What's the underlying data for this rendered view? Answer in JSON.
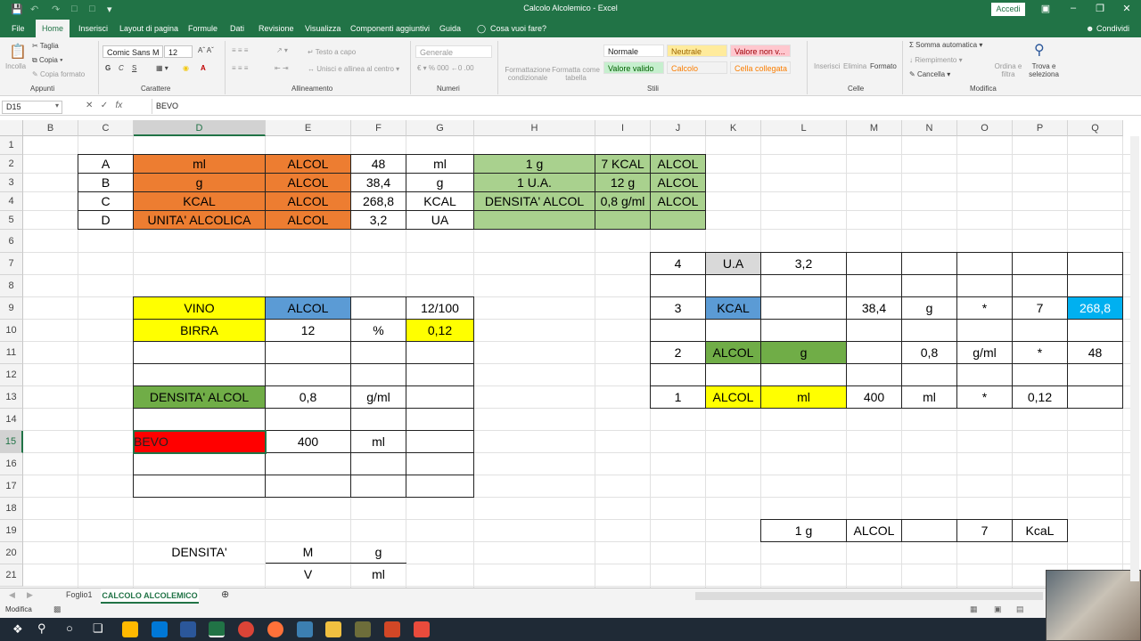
{
  "window": {
    "title": "Calcolo Alcolemico - Excel",
    "signin": "Accedi",
    "share": "Condividi"
  },
  "tabs": [
    "File",
    "Home",
    "Inserisci",
    "Layout di pagina",
    "Formule",
    "Dati",
    "Revisione",
    "Visualizza",
    "Componenti aggiuntivi",
    "Guida",
    "Cosa vuoi fare?"
  ],
  "ribbon": {
    "clipboard": {
      "paste": "Incolla",
      "cut": "Taglia",
      "copy": "Copia",
      "painter": "Copia formato",
      "group": "Appunti"
    },
    "font": {
      "name": "Comic Sans M",
      "size": "12",
      "group": "Carattere"
    },
    "align": {
      "wrap": "Testo a capo",
      "merge": "Unisci e allinea al centro",
      "group": "Allineamento"
    },
    "number": {
      "format": "Generale",
      "group": "Numeri"
    },
    "styles": {
      "cond": "Formattazione condizionale",
      "table": "Formatta come tabella",
      "s1": "Normale",
      "s2": "Neutrale",
      "s3": "Valore non v...",
      "s4": "Valore valido",
      "s5": "Calcolo",
      "s6": "Cella collegata",
      "group": "Stili"
    },
    "cells": {
      "insert": "Inserisci",
      "delete": "Elimina",
      "format": "Formato",
      "group": "Celle"
    },
    "editing": {
      "autosum": "Somma automatica",
      "fill": "Riempimento",
      "clear": "Cancella",
      "sort": "Ordina e filtra",
      "find": "Trova e seleziona",
      "group": "Modifica"
    }
  },
  "formula_bar": {
    "name_box": "D15",
    "content": "BEVO"
  },
  "columns": [
    "B",
    "C",
    "D",
    "E",
    "F",
    "G",
    "H",
    "I",
    "J",
    "K",
    "L",
    "M",
    "N",
    "O",
    "P",
    "Q"
  ],
  "rows": [
    "1",
    "2",
    "3",
    "4",
    "5",
    "6",
    "7",
    "8",
    "9",
    "10",
    "11",
    "12",
    "13",
    "14",
    "15",
    "16",
    "17",
    "18",
    "19",
    "20",
    "21"
  ],
  "cells": {
    "C2": "A",
    "D2": "ml",
    "E2": "ALCOL",
    "F2": "48",
    "G2": "ml",
    "H2": "1 g",
    "I2": "7 KCAL",
    "J2": "ALCOL",
    "C3": "B",
    "D3": "g",
    "E3": "ALCOL",
    "F3": "38,4",
    "G3": "g",
    "H3": "1 U.A.",
    "I3": "12 g",
    "J3": "ALCOL",
    "C4": "C",
    "D4": "KCAL",
    "E4": "ALCOL",
    "F4": "268,8",
    "G4": "KCAL",
    "H4": "DENSITA' ALCOL",
    "I4": "0,8 g/ml",
    "J4": "ALCOL",
    "C5": "D",
    "D5": "UNITA' ALCOLICA",
    "E5": "ALCOL",
    "F5": "3,2",
    "G5": "UA",
    "J7": "4",
    "K7": "U.A",
    "L7": "3,2",
    "D9": "VINO",
    "E9": "ALCOL",
    "G9": "12/100",
    "J9": "3",
    "K9": "KCAL",
    "M9": "38,4",
    "N9": "g",
    "O9": "*",
    "P9": "7",
    "Q9": "268,8",
    "D10": "BIRRA",
    "E10": "12",
    "F10": "%",
    "G10": "0,12",
    "J11": "2",
    "K11": "ALCOL",
    "L11": "g",
    "N11": "0,8",
    "O11": "g/ml",
    "P11": "*",
    "Q11": "48",
    "D13": "DENSITA' ALCOL",
    "E13": "0,8",
    "F13": "g/ml",
    "J13": "1",
    "K13": "ALCOL",
    "L13": "ml",
    "M13": "400",
    "N13": "ml",
    "O13": "*",
    "P13": "0,12",
    "D15": "BEVO",
    "E15": "400",
    "F15": "ml",
    "L19": "1 g",
    "M19": "ALCOL",
    "O19": "7",
    "P19": "KcaL",
    "D20": "DENSITA'",
    "E20": "M",
    "F20": "g",
    "E21": "V",
    "F21": "ml"
  },
  "sheets": [
    "Foglio1",
    "CALCOLO ALCOLEMICO"
  ],
  "status": {
    "mode": "Modifica"
  },
  "colors": {
    "excel_green": "#217346",
    "orange": "#ed7d31",
    "green_cell": "#a9d18e",
    "green_dark": "#70ad47",
    "yellow": "#ffff00",
    "blue": "#5b9bd5",
    "cyan": "#00b0f0",
    "red": "#ff0000",
    "gray": "#d9d9d9"
  }
}
